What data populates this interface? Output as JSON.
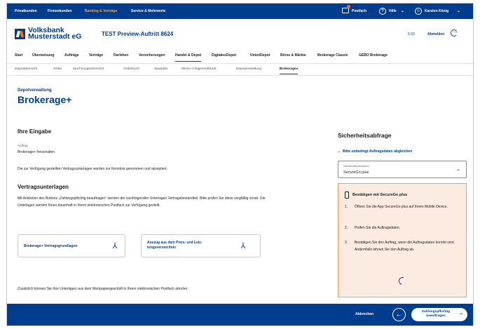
{
  "topbar": {
    "segments": [
      "Privatkunden",
      "Firmenkunden",
      "Banking & Verträge",
      "Service & Mehrwerte"
    ],
    "postbox": "Postfach",
    "help": "Hilfe",
    "user": "Karsten König"
  },
  "header": {
    "bank_line1": "Volksbank",
    "bank_line2": "Musterstadt eG",
    "preview_title": "TEST Preview-Auftritt 8624",
    "timer": "5:33",
    "logout": "Abmelden"
  },
  "mainnav": [
    "Start",
    "Überweisung",
    "Aufträge",
    "Verträge",
    "Darlehen",
    "Versicherungen",
    "Handel & Depot",
    "DigitalesDepot",
    "UnionDepot",
    "Börse & Märkte",
    "Brokerage Classic",
    "GEBO Brokerage"
  ],
  "subnav": [
    "Depotübersicht",
    "Order",
    "Zeichnungsübersicht",
    "Orderbuch",
    "Sparplan",
    "Meine Anlagezertifikate",
    "Depotverwaltung",
    "Brokerages"
  ],
  "page": {
    "kicker": "Depotverwaltung",
    "title": "Brokerage+"
  },
  "input": {
    "heading": "Ihre Eingabe",
    "field_label": "Auftrag",
    "field_value": "Brokerage+ freischalten",
    "confirm_text": "Die zur Verfügung gestellten Vertragsunterlagen wurden zur Kenntnis genommen und akzeptiert."
  },
  "docs": {
    "heading": "Vertragsunterlagen",
    "intro": "Mit Anklicken des Buttons „Zahlungspflichtig beauftragen“ werden die nachfolgenden Unterlagen Vertragsbestandteil. Bitte prüfen Sie diese sorgfältig vorab. Die Unterlagen werden Ihnen dauerhaft in Ihrem elektronischen Postfach zur Verfügung gestellt.",
    "card1": "Brokerage+ Vertragsgrundlagen",
    "card2_line1": "Auszug aus dem Preis- und Leis-",
    "card2_line2": "tungsverzeichnis",
    "footnote": "Zusätzlich können Sie Ihre Unterlagen aus dem Wertpapiergeschäft in Ihrem elektronischen Postfach abrufen."
  },
  "security": {
    "heading": "Sicherheitsabfrage",
    "collapse": "Bitte unbedingt Auftragsdaten abgleichen",
    "select_label": "Sicherheitsverfahren",
    "select_value": "SecureGo plus",
    "box_title": "Bestätigen mit SecureGo plus",
    "steps": [
      {
        "num": "1.",
        "text": "Öffnen Sie die App SecureGo plus auf Ihrem Mobile Device."
      },
      {
        "num": "2.",
        "text": "Prüfen Sie die Auftragsdaten."
      },
      {
        "num": "3.",
        "text": "Bestätigen Sie den Auftrag, wenn die Auftragsdaten korrekt sind. Andernfalls lehnen Sie den Auftrag ab."
      }
    ]
  },
  "footer": {
    "cancel": "Abbrechen",
    "submit_line1": "Zahlungspflichtig",
    "submit_line2": "beauftragen"
  }
}
